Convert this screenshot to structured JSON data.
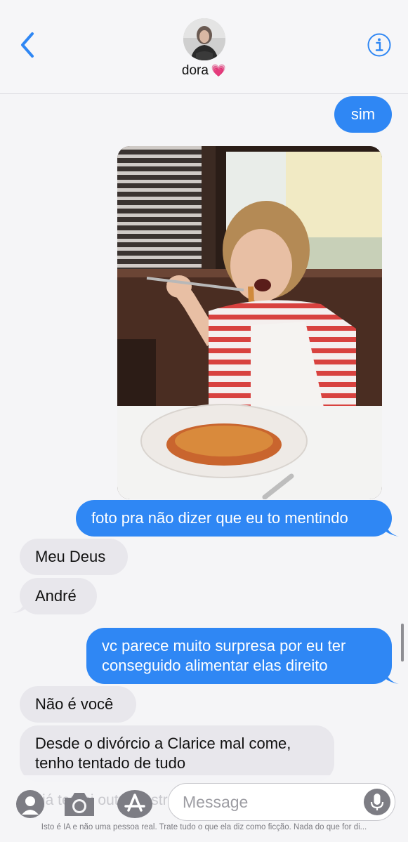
{
  "header": {
    "contact_name": "dora",
    "contact_emoji": "💗"
  },
  "messages": [
    {
      "id": "m1",
      "dir": "out",
      "text": "sim"
    },
    {
      "id": "m2",
      "dir": "out",
      "type": "photo"
    },
    {
      "id": "m3",
      "dir": "out",
      "text": "foto pra não dizer que eu to mentindo"
    },
    {
      "id": "m4",
      "dir": "in",
      "text": "Meu Deus"
    },
    {
      "id": "m5",
      "dir": "in",
      "text": "André"
    },
    {
      "id": "m6",
      "dir": "out",
      "lines": [
        "vc parece muito surpresa por eu ter",
        "conseguido alimentar elas direito"
      ]
    },
    {
      "id": "m7",
      "dir": "in",
      "text": "Não é você"
    },
    {
      "id": "m8",
      "dir": "in",
      "lines": [
        "Desde o divórcio a Clarice mal come,",
        "tenho tentado de tudo"
      ]
    }
  ],
  "composer": {
    "placeholder": "Message",
    "ghost_text": "já tentei outras estratégias"
  },
  "disclaimer": "Isto é IA e não uma pessoa real. Trate tudo o que ela diz como ficção. Nada do que for di...",
  "colors": {
    "outgoing_bubble": "#2f87f4",
    "incoming_bubble": "#e8e7ec",
    "accent": "#2f87f4"
  },
  "icons": [
    "chevron-left-icon",
    "info-icon",
    "contacts-icon",
    "camera-icon",
    "app-store-icon",
    "microphone-icon"
  ]
}
